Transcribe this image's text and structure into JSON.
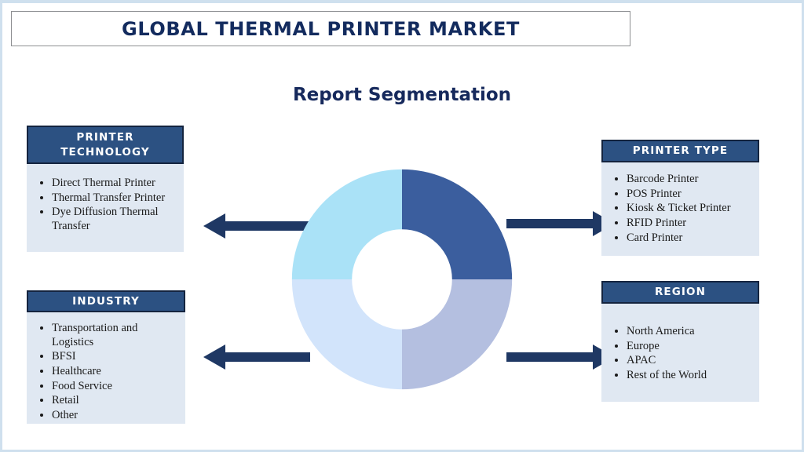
{
  "header": {
    "title": "GLOBAL THERMAL PRINTER MARKET"
  },
  "subtitle": "Report Segmentation",
  "colors": {
    "title_text": "#132b5e",
    "header_fill": "#2c5182",
    "header_border": "#14243f",
    "body_fill": "#e0e8f2",
    "arrow": "#1f3864",
    "frame": "#cfe0ee",
    "donut_top_right": "#3b5e9e",
    "donut_bottom_right": "#b4bfe0",
    "donut_bottom_left": "#d2e4fb",
    "donut_top_left": "#aae2f7"
  },
  "segments": [
    {
      "id": "printer-technology",
      "title": "PRINTER TECHNOLOGY",
      "items": [
        "Direct Thermal Printer",
        "Thermal Transfer Printer",
        "Dye Diffusion Thermal Transfer"
      ]
    },
    {
      "id": "industry",
      "title": "INDUSTRY",
      "items": [
        "Transportation and Logistics",
        "BFSI",
        "Healthcare",
        "Food Service",
        "Retail",
        "Other"
      ]
    },
    {
      "id": "printer-type",
      "title": "PRINTER TYPE",
      "items": [
        "Barcode Printer",
        "POS Printer",
        "Kiosk & Ticket Printer",
        "RFID Printer",
        "Card Printer"
      ]
    },
    {
      "id": "region",
      "title": "REGION",
      "items": [
        "North America",
        "Europe",
        "APAC",
        "Rest of the World"
      ]
    }
  ],
  "chart_data": {
    "type": "pie",
    "variant": "donut",
    "title": "Report Segmentation",
    "labels": [
      "Printer Type",
      "Region",
      "Industry",
      "Printer Technology"
    ],
    "values": [
      25,
      25,
      25,
      25
    ],
    "colors": [
      "#3b5e9e",
      "#b4bfe0",
      "#d2e4fb",
      "#aae2f7"
    ],
    "legend": "none",
    "grid": false,
    "notes": "Four equal quadrants; top-right dark blue, bottom-right periwinkle, bottom-left pale blue, top-left light cyan. Inner hole radius is about 45% of outer radius."
  },
  "arrows": [
    {
      "id": "arrow-left-top",
      "direction": "left",
      "connects": "printer-technology"
    },
    {
      "id": "arrow-left-bottom",
      "direction": "left",
      "connects": "industry"
    },
    {
      "id": "arrow-right-top",
      "direction": "right",
      "connects": "printer-type"
    },
    {
      "id": "arrow-right-bottom",
      "direction": "right",
      "connects": "region"
    }
  ]
}
